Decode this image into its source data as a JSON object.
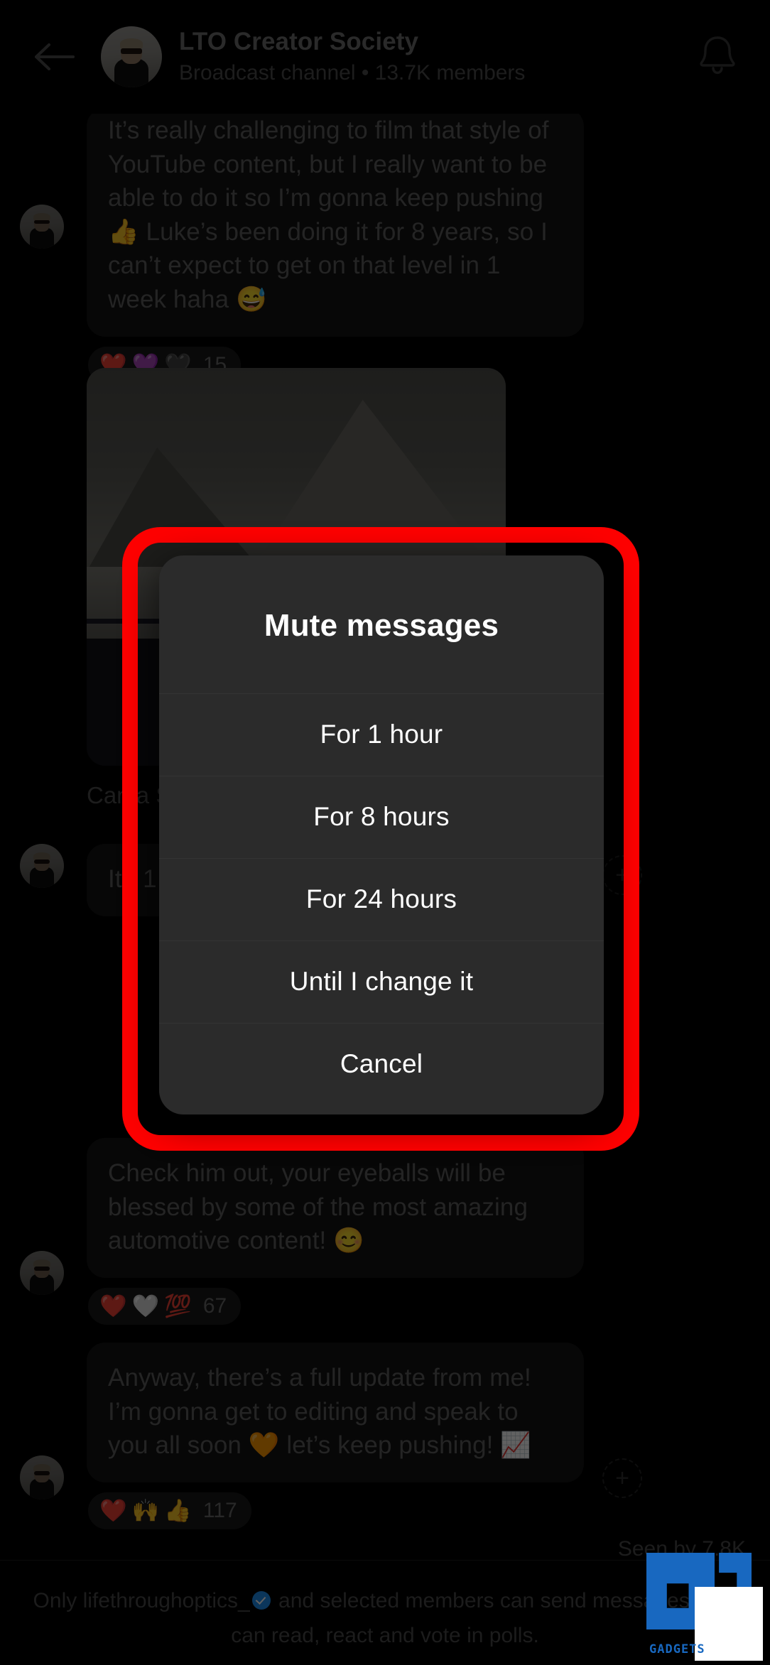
{
  "header": {
    "back_icon": "arrow-left-icon",
    "channel_name": "LTO Creator Society",
    "channel_subtitle": "Broadcast channel • 13.7K members",
    "bell_icon": "bell-icon"
  },
  "messages": [
    {
      "id": "msg-1",
      "text": "It’s really challenging to film that style of YouTube content, but I really want to be able to do it so I’m gonna keep pushing 👍 Luke’s been doing it for 8 years, so I can’t expect to get on that level in 1 week haha 😅",
      "reactions": [
        "❤️",
        "💜",
        "🖤"
      ],
      "reaction_count": "15"
    },
    {
      "id": "msg-2-photo",
      "caption": "Can  a  Stay  and",
      "has_photo": true
    },
    {
      "id": "msg-3",
      "text": "It  t  1  C",
      "add_reaction_icon": "add-reaction-icon"
    },
    {
      "id": "msg-4",
      "text": "Check him out, your eyeballs will be blessed by some of the most amazing automotive content! 😊",
      "reactions": [
        "❤️",
        "🤍",
        "💯"
      ],
      "reaction_count": "67"
    },
    {
      "id": "msg-5",
      "text": "Anyway, there’s a full update from me! I’m gonna get to editing and speak to you all soon 🧡 let’s keep pushing! 📈",
      "reactions": [
        "❤️",
        "🙌",
        "👍"
      ],
      "reaction_count": "117",
      "add_reaction_icon": "add-reaction-icon"
    }
  ],
  "seen_by": "Seen by 7.8K",
  "footer": {
    "text_before": "Only lifethroughoptics_",
    "verified_icon": "verified-badge-icon",
    "text_after": " and selected members can send messages. You can read, react and vote in polls."
  },
  "dialog": {
    "title": "Mute messages",
    "options": [
      {
        "label": "For 1 hour"
      },
      {
        "label": "For 8 hours"
      },
      {
        "label": "For 24 hours"
      },
      {
        "label": "Until I change it"
      },
      {
        "label": "Cancel"
      }
    ]
  },
  "highlight": {
    "color": "#fe0000",
    "shape": "rounded-rectangle"
  },
  "watermark": {
    "label": "GADGETS"
  },
  "colors": {
    "background": "#000000",
    "bubble": "#141414",
    "dialog_surface": "#2b2b2b",
    "accent_red": "#fe0000",
    "verified_blue": "#1d8ef0"
  }
}
